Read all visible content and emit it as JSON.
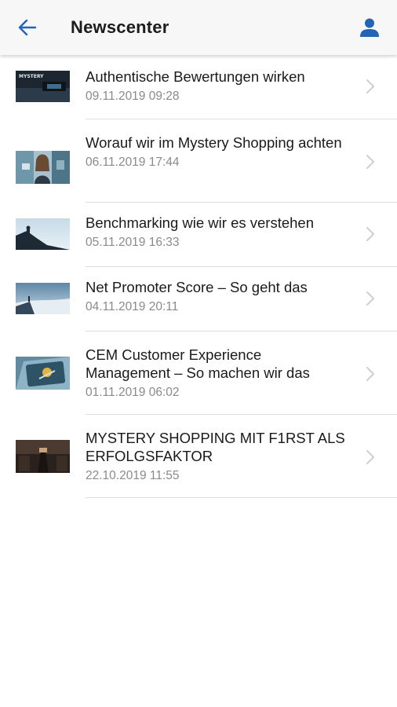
{
  "header": {
    "title": "Newscenter",
    "back_icon": "arrow-left-icon",
    "profile_icon": "person-icon",
    "accent_color": "#2563b4"
  },
  "articles": [
    {
      "title": "Authentische Bewertungen wirken",
      "date": "09.11.2019 09:28",
      "thumb_text": "MYSTERY"
    },
    {
      "title": "Worauf wir im Mystery Shopping achten",
      "date": "06.11.2019 17:44"
    },
    {
      "title": "Benchmarking wie wir es verstehen",
      "date": "05.11.2019 16:33"
    },
    {
      "title": "Net Promoter Score – So geht das",
      "date": "04.11.2019 20:11"
    },
    {
      "title": "CEM Customer Experience Management – So machen wir das",
      "date": "01.11.2019 06:02"
    },
    {
      "title": "MYSTERY SHOPPING MIT F1RST ALS ERFOLGSFAKTOR",
      "date": "22.10.2019 11:55"
    }
  ]
}
